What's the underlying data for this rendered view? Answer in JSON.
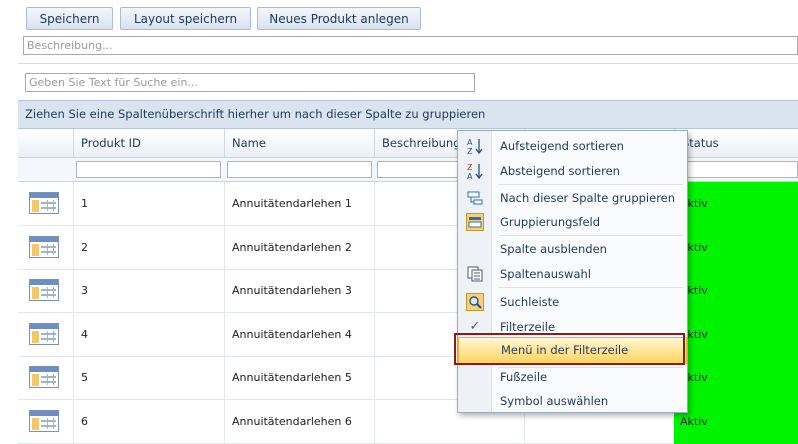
{
  "toolbar": {
    "save_label": "Speichern",
    "save_layout_label": "Layout speichern",
    "new_product_label": "Neues Produkt anlegen"
  },
  "description_placeholder": "Beschreibung...",
  "search_placeholder": "Geben Sie Text für Suche ein...",
  "group_panel_text": "Ziehen Sie eine Spaltenüberschrift hierher um nach dieser Spalte zu gruppieren",
  "columns": {
    "product_id": "Produkt ID",
    "name": "Name",
    "description": "Beschreibung",
    "status": "Status"
  },
  "rows": [
    {
      "id": "1",
      "name": "Annuitätendarlehen 1",
      "status": "Aktiv"
    },
    {
      "id": "2",
      "name": "Annuitätendarlehen 2",
      "status": "Aktiv"
    },
    {
      "id": "3",
      "name": "Annuitätendarlehen 3",
      "status": "Aktiv"
    },
    {
      "id": "4",
      "name": "Annuitätendarlehen 4",
      "status": "Aktiv"
    },
    {
      "id": "5",
      "name": "Annuitätendarlehen 5",
      "status": "Aktiv"
    },
    {
      "id": "6",
      "name": "Annuitätendarlehen 6",
      "status": "Aktiv"
    }
  ],
  "status_color": "#00f400",
  "context_menu": {
    "items": [
      {
        "label": "Aufsteigend sortieren",
        "icon": "sort-ascending-icon"
      },
      {
        "label": "Absteigend sortieren",
        "icon": "sort-descending-icon"
      },
      {
        "label": "Nach dieser Spalte gruppieren",
        "icon": "group-by-column-icon"
      },
      {
        "label": "Gruppierungsfeld",
        "icon": "group-panel-icon"
      },
      {
        "label": "Spalte ausblenden",
        "icon": ""
      },
      {
        "label": "Spaltenauswahl",
        "icon": "column-chooser-icon"
      },
      {
        "label": "Suchleiste",
        "icon": "search-panel-icon"
      },
      {
        "label": "Filterzeile",
        "icon": "checkmark-icon"
      },
      {
        "label": "Menü in der Filterzeile",
        "icon": ""
      },
      {
        "label": "Fußzeile",
        "icon": ""
      },
      {
        "label": "Symbol auswählen",
        "icon": ""
      }
    ]
  }
}
